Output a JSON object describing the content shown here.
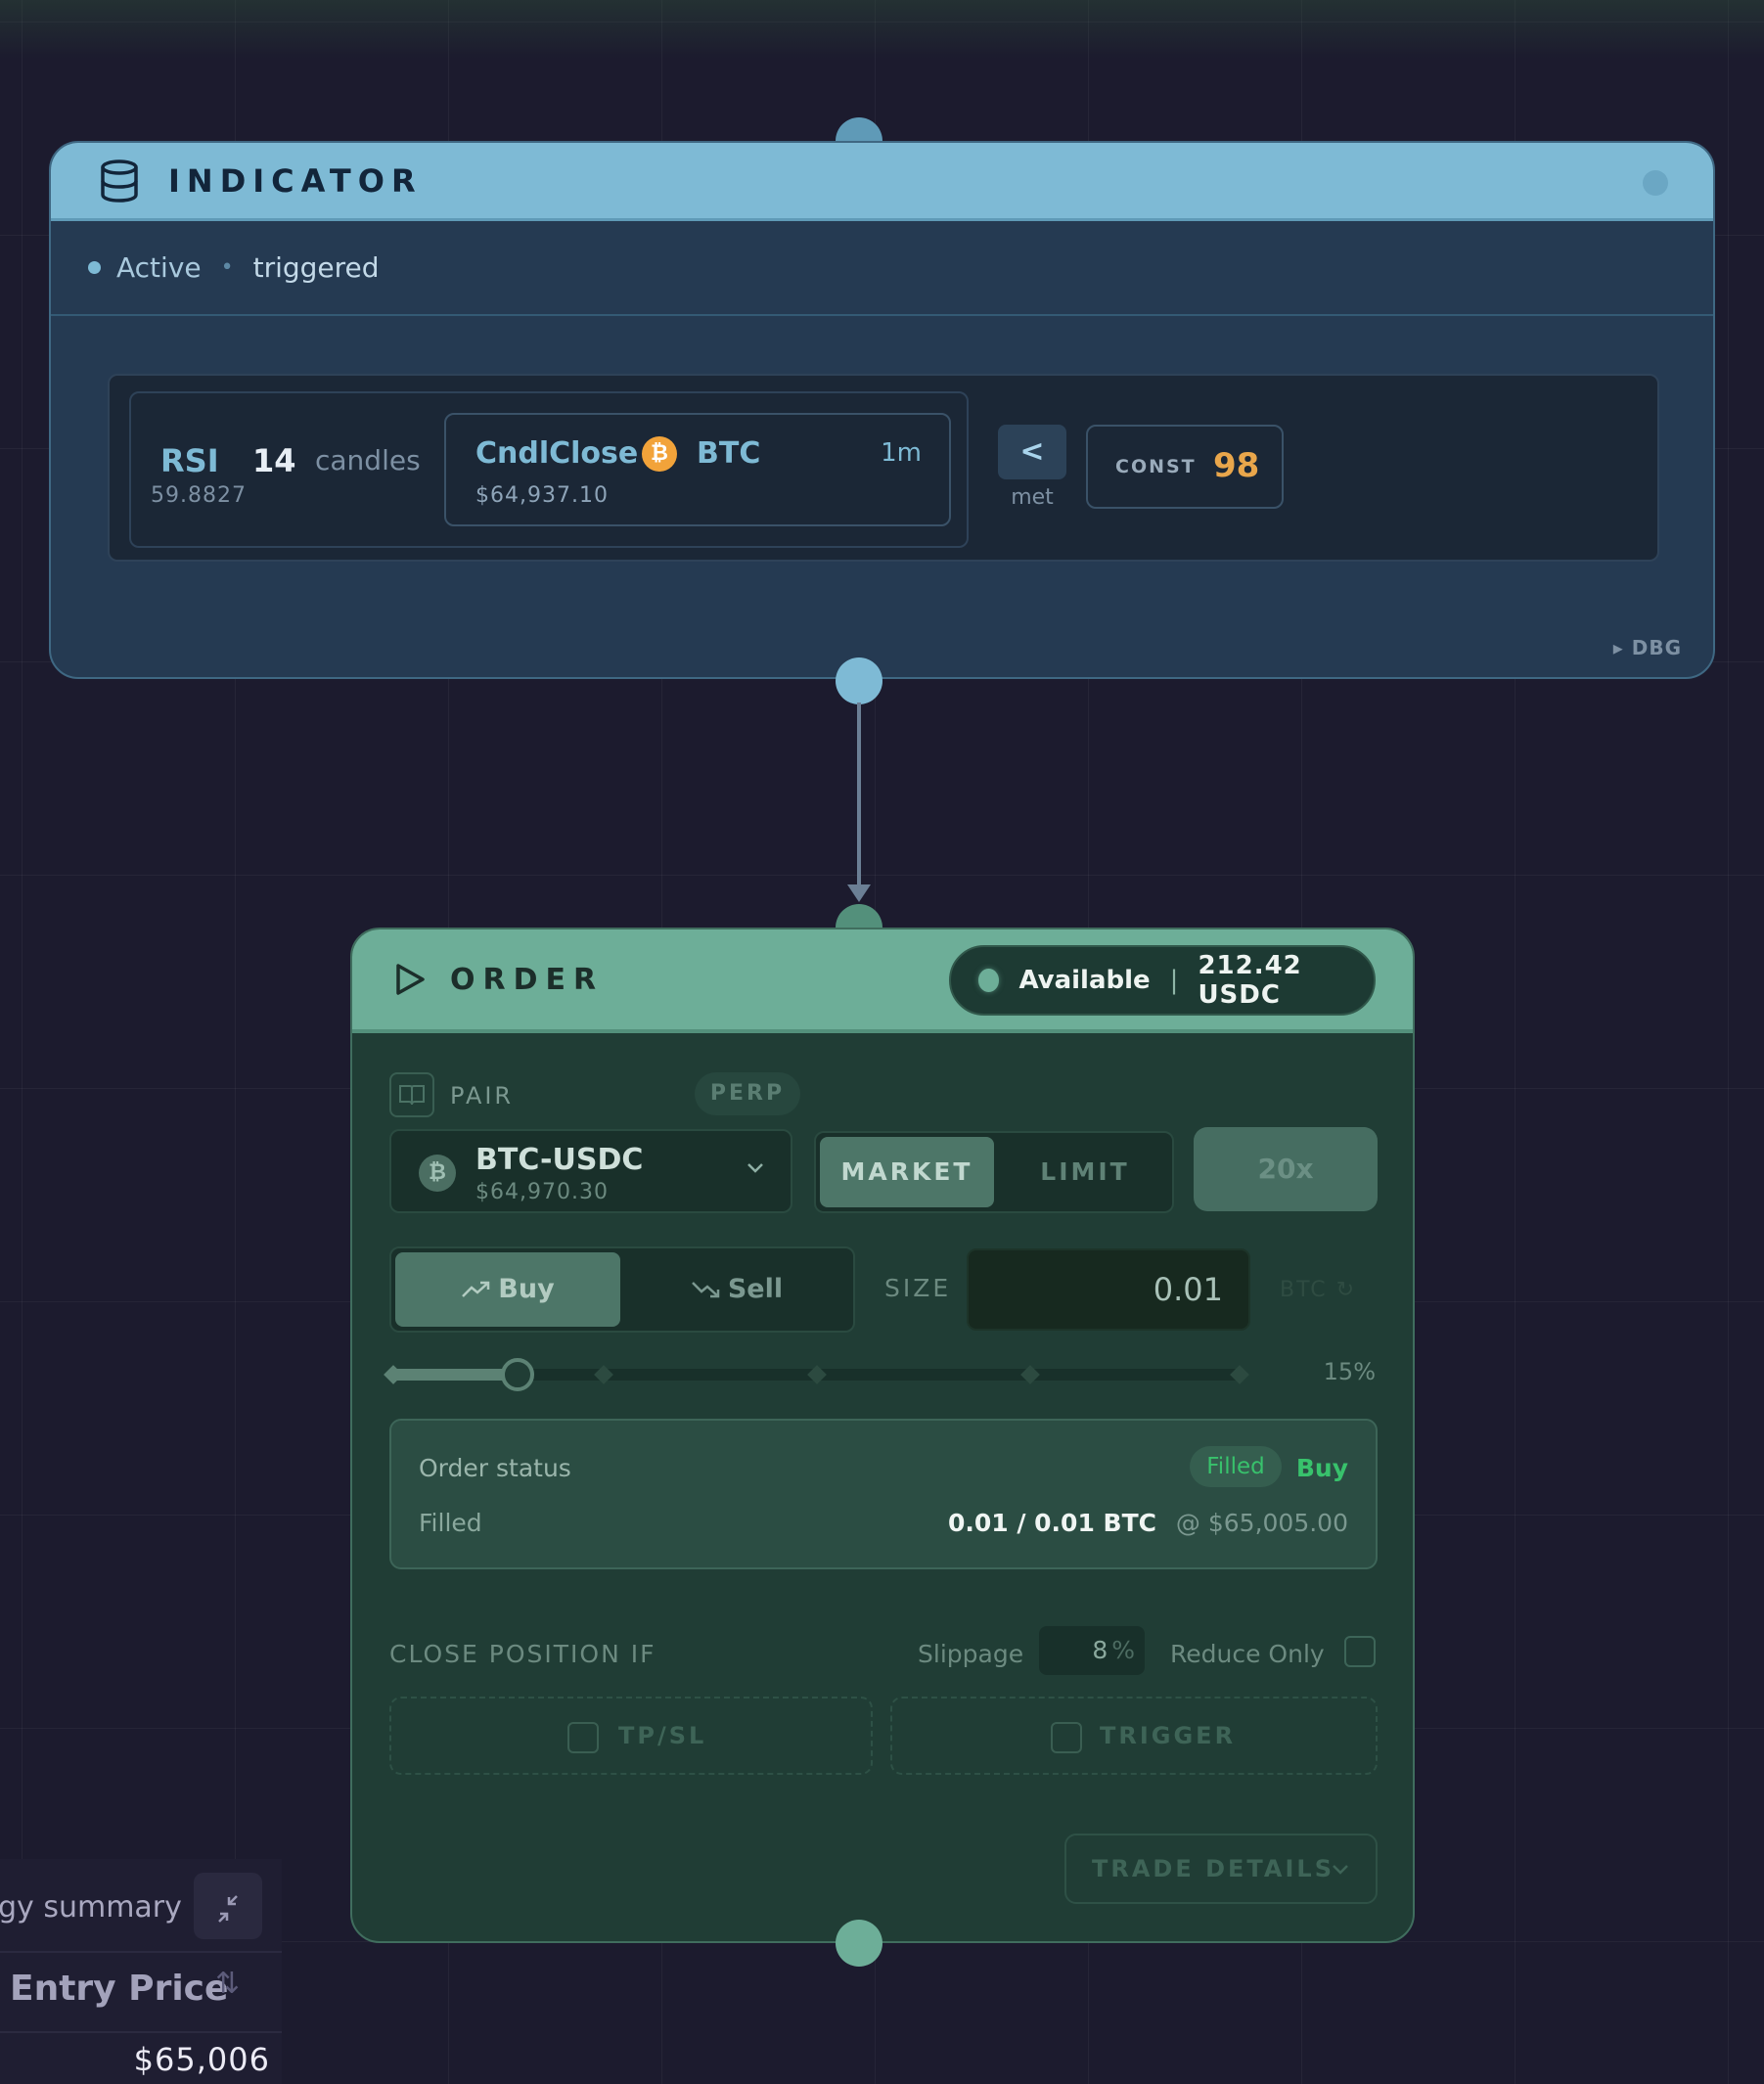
{
  "indicator": {
    "title": "INDICATOR",
    "status_active": "Active",
    "status_triggered": "triggered",
    "rsi": {
      "label": "RSI",
      "period": "14",
      "unit": "candles",
      "value": "59.8827"
    },
    "source": {
      "name": "CndlClose",
      "coin_glyph": "₿",
      "symbol": "BTC",
      "timeframe": "1m",
      "price": "$64,937.10"
    },
    "comparator": "<",
    "comparator_state": "met",
    "const_label": "CONST",
    "const_value": "98",
    "debug_label": "▸ DBG",
    "colors": {
      "header": "#7ebad5",
      "body": "#253a52"
    }
  },
  "order": {
    "title": "ORDER",
    "available_label": "Available",
    "available_separator": "|",
    "available_balance": "212.42 USDC",
    "pair_label": "PAIR",
    "market_type": "PERP",
    "pair_glyph": "₿",
    "pair_name": "BTC-USDC",
    "pair_price": "$64,970.30",
    "order_types": [
      "MARKET",
      "LIMIT"
    ],
    "leverage": "20x",
    "sides": [
      "Buy",
      "Sell"
    ],
    "size_label": "SIZE",
    "size_value": "0.01",
    "size_unit": "BTC ↻",
    "size_percent_label": "15%",
    "size_percent": 15,
    "order_status": {
      "title": "Order status",
      "badge": "Filled",
      "side": "Buy",
      "filled_label": "Filled",
      "filled_qty": "0.01 / 0.01 BTC",
      "fill_price": "@ $65,005.00"
    },
    "close_position_label": "CLOSE POSITION IF",
    "slippage_label": "Slippage",
    "slippage_value": "8",
    "slippage_unit": "%",
    "reduce_only_label": "Reduce Only",
    "tpsl_label": "TP/SL",
    "trigger_label": "TRIGGER",
    "trade_details_label": "TRADE DETAILS",
    "colors": {
      "header": "#6dae98",
      "body": "#203d35",
      "filled": "#38c26c"
    }
  },
  "summary": {
    "title": "gy summary",
    "column": "Entry Price",
    "sort_glyph": "⇅",
    "entry_value": "$65,006"
  }
}
